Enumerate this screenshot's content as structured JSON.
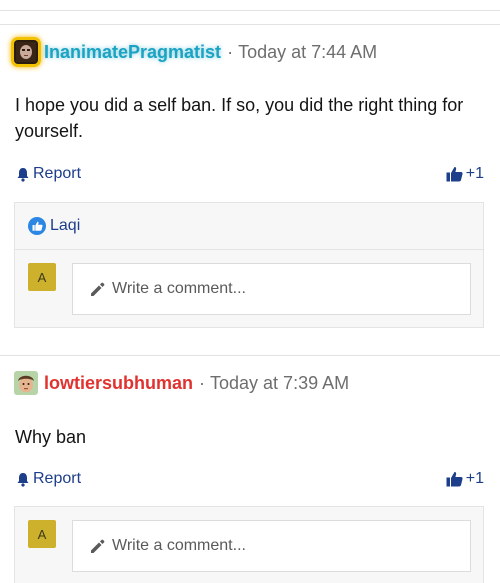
{
  "posts": [
    {
      "author": "InanimatePragmatist",
      "time": "Today at 7:44 AM",
      "body": "I hope you did a self ban. If so, you did the right thing for yourself.",
      "report_label": "Report",
      "likes": "+1",
      "likers": [
        "Laqi"
      ],
      "comment_avatar_letter": "A",
      "comment_placeholder": "Write a comment..."
    },
    {
      "author": "lowtiersubhuman",
      "time": "Today at 7:39 AM",
      "body": "Why ban",
      "report_label": "Report",
      "likes": "+1",
      "comment_avatar_letter": "A",
      "comment_placeholder": "Write a comment..."
    }
  ],
  "separator": "·",
  "colors": {
    "link_blue": "#1d3e8a",
    "author_teal": "#1aa3c2",
    "author_red": "#e0332f",
    "comment_avatar": "#cdb12c",
    "like_badge": "#2b87e3"
  },
  "icons": [
    "bell-icon",
    "thumbs-up-icon",
    "pencil-icon",
    "like-badge-icon"
  ]
}
